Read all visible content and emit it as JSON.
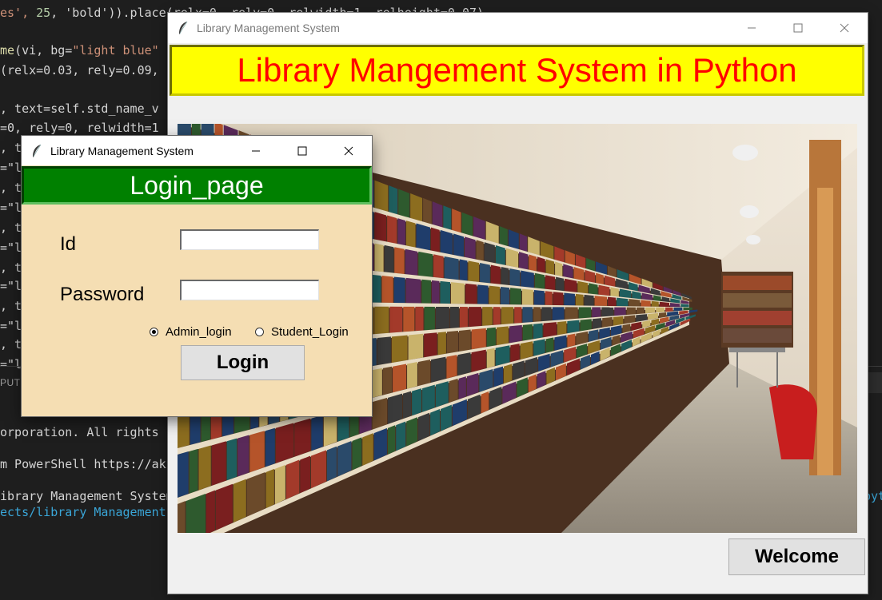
{
  "editor": {
    "code_lines": [
      {
        "pre": "es', ",
        "num": "25",
        "mid": ", 'bold')).place(relx=0, rely=0, relwidth=1, relheight=0.07)"
      },
      {
        "fn": "me",
        "mid": "(vi, bg=",
        "str": "\"light blue\""
      },
      {
        "mid": "(relx=0.03, rely=0.09,"
      },
      {
        "mid": ", text=self.std_name_v"
      },
      {
        "mid": "=0, rely=0, relwidth=1"
      },
      {
        "mid": ", t"
      },
      {
        "mid": "=\"l"
      },
      {
        "mid": ", t"
      },
      {
        "mid": "=\"l"
      },
      {
        "mid": ", t"
      },
      {
        "mid": "=\"l"
      },
      {
        "mid": ", t"
      },
      {
        "mid": "=\"l"
      },
      {
        "mid": ", t"
      },
      {
        "mid": "=\"l"
      },
      {
        "mid": ", t"
      },
      {
        "mid": "=\"l"
      }
    ],
    "panel_tab": "PUT",
    "terminal_lines": [
      "orporation. All rights",
      "",
      "m PowerShell https://ak",
      "",
      "ibrary Management System"
    ],
    "terminal_path": "ects/library Management",
    "terminal_right": "pyt"
  },
  "main_window": {
    "title": "Library Management System",
    "banner": "Library Mangement System in Python",
    "welcome_button": "Welcome"
  },
  "login_window": {
    "title": "Library Management System",
    "header": "Login_page",
    "id_label": "Id",
    "password_label": "Password",
    "id_value": "",
    "password_value": "",
    "radio_admin": "Admin_login",
    "radio_student": "Student_Login",
    "selected_radio": "admin",
    "login_button": "Login"
  },
  "colors": {
    "banner_bg": "#ffff00",
    "banner_text": "#ff0000",
    "login_header_bg": "#008000",
    "login_bg": "#f5deb3"
  }
}
